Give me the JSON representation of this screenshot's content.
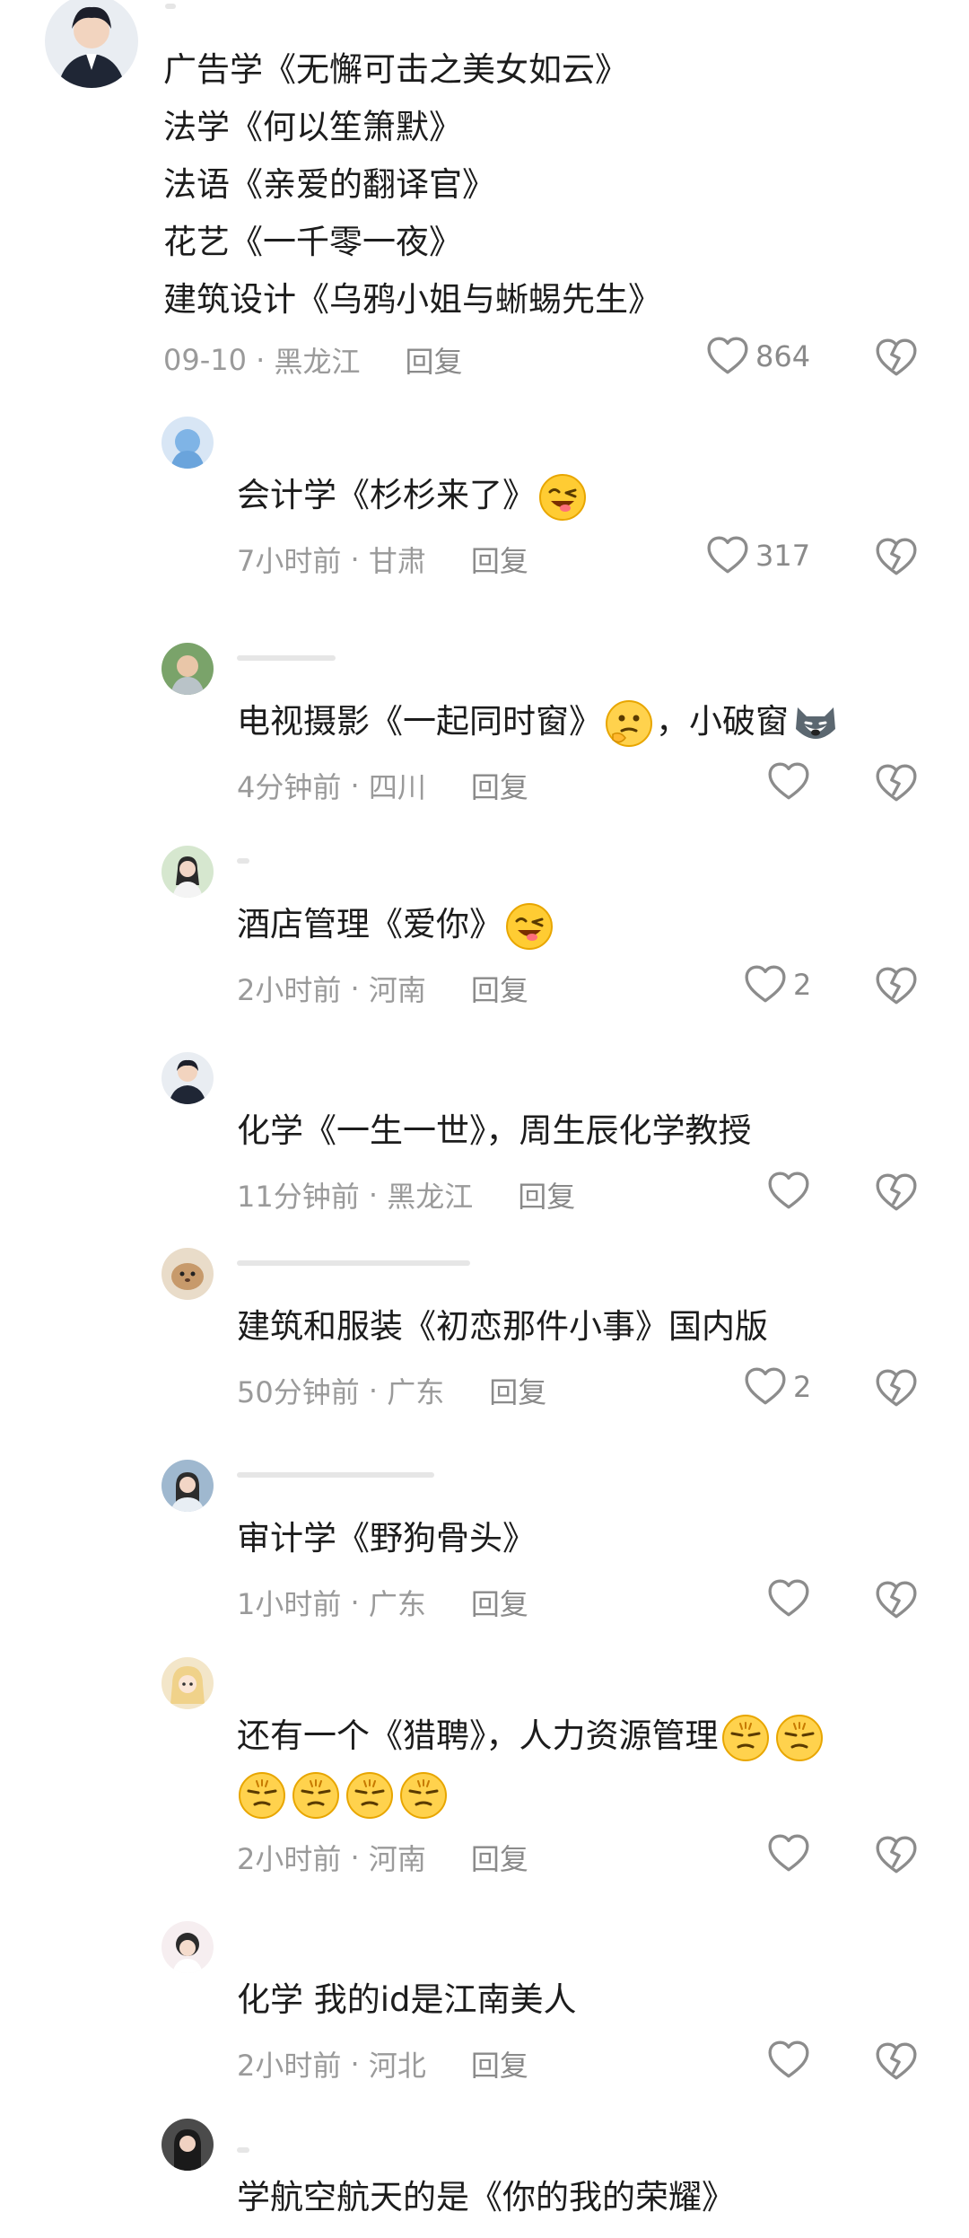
{
  "comments": [
    {
      "lines": [
        "广告学《无懈可击之美女如云》",
        "法学《何以笙箫默》",
        "法语《亲爱的翻译官》",
        "花艺《一千零一夜》",
        "建筑设计《乌鸦小姐与蜥蜴先生》"
      ],
      "time": "09-10",
      "location": "黑龙江",
      "reply": "回复",
      "likes": "864"
    },
    {
      "text": "会计学《杉杉来了》",
      "time": "7小时前",
      "location": "甘肃",
      "reply": "回复",
      "likes": "317",
      "emoji": "wink"
    },
    {
      "text": "电视摄影《一起同时窗》",
      "tail": "，小破窗",
      "time": "4分钟前",
      "location": "四川",
      "reply": "回复",
      "likes": "",
      "emoji": "thinking",
      "emoji2": "husky"
    },
    {
      "text": "酒店管理《爱你》",
      "time": "2小时前",
      "location": "河南",
      "reply": "回复",
      "likes": "2",
      "emoji": "wink"
    },
    {
      "text": "化学《一生一世》，周生辰化学教授",
      "time": "11分钟前",
      "location": "黑龙江",
      "reply": "回复",
      "likes": ""
    },
    {
      "text": "建筑和服装《初恋那件小事》国内版",
      "time": "50分钟前",
      "location": "广东",
      "reply": "回复",
      "likes": "2"
    },
    {
      "text": "审计学《野狗骨头》",
      "time": "1小时前",
      "location": "广东",
      "reply": "回复",
      "likes": ""
    },
    {
      "text": "还有一个《猎聘》，人力资源管理",
      "time": "2小时前",
      "location": "河南",
      "reply": "回复",
      "likes": "",
      "emoji": "grumpy"
    },
    {
      "text": "化学 我的id是江南美人",
      "time": "2小时前",
      "location": "河北",
      "reply": "回复",
      "likes": ""
    },
    {
      "text": "学航空航天的是《你的我的荣耀》"
    }
  ],
  "icons": {
    "like": "heart-outline-icon",
    "dislike": "broken-heart-icon"
  },
  "colors": {
    "text": "#1c1c1c",
    "meta": "#9a9a9a",
    "icon": "#8c8c8c"
  }
}
